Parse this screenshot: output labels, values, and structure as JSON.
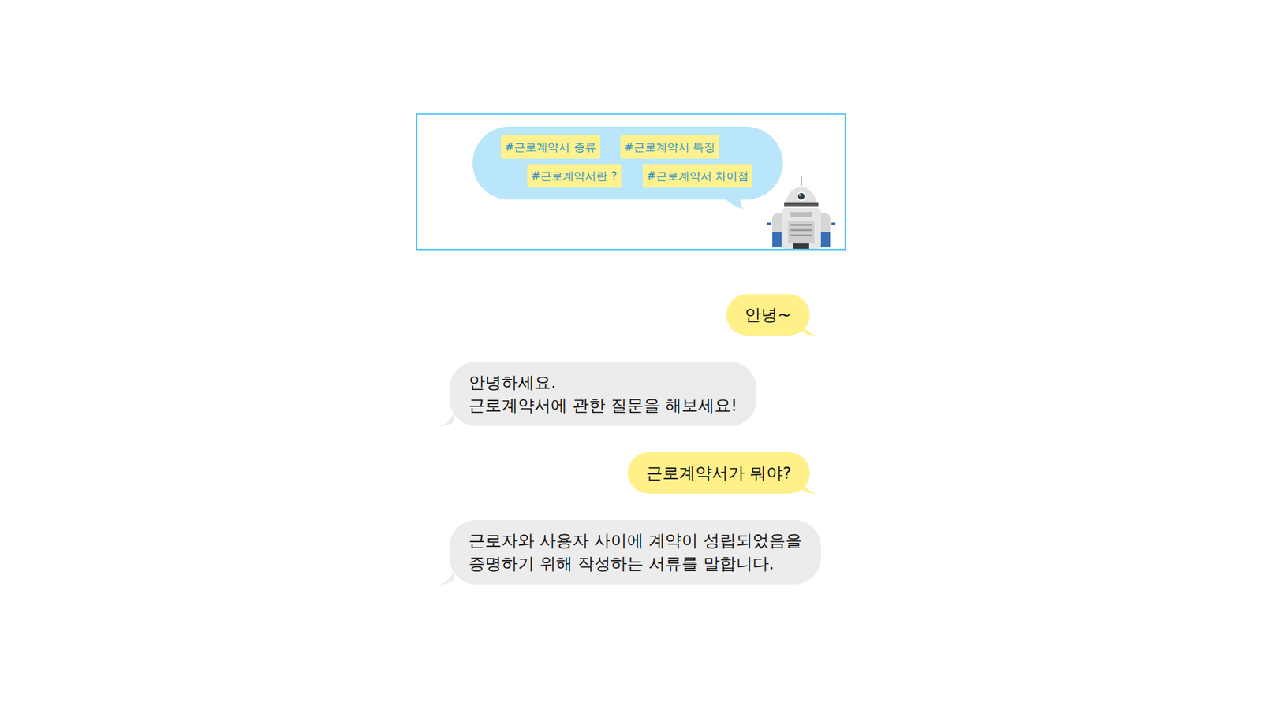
{
  "banner": {
    "tags": [
      "#근로계약서 종류",
      "#근로계약서 특징",
      "#근로계약서란 ?",
      "#근로계약서 차이점"
    ]
  },
  "messages": [
    {
      "kind": "user",
      "lines": [
        "안녕~"
      ]
    },
    {
      "kind": "bot",
      "lines": [
        "안녕하세요.",
        "근로계약서에 관한 질문을 해보세요!"
      ]
    },
    {
      "kind": "user",
      "lines": [
        "근로계약서가 뭐야?"
      ]
    },
    {
      "kind": "bot",
      "lines": [
        "근로자와 사용자 사이에 계약이 성립되었음을",
        "증명하기 위해 작성하는 서류를 말합니다."
      ]
    }
  ]
}
